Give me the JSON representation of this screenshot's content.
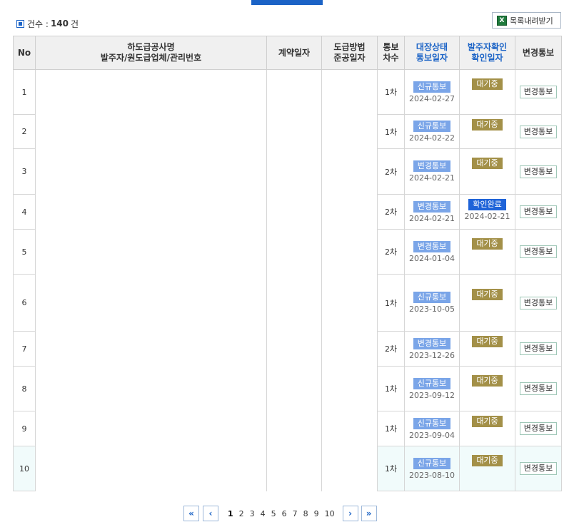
{
  "summary": {
    "label": "건수 :",
    "count": "140",
    "unit": "건"
  },
  "toolbar": {
    "download_label": "목록내려받기",
    "excel_icon": "X"
  },
  "table": {
    "headers": {
      "no": "No",
      "name_line1": "하도급공사명",
      "name_line2": "발주자/원도급업체/관리번호",
      "contract": "계약일자",
      "method_line1": "도급방법",
      "method_line2": "준공일자",
      "seq_line1": "통보",
      "seq_line2": "차수",
      "ledger_line1": "대장상태",
      "ledger_line2": "통보일자",
      "confirm_line1": "발주자확인",
      "confirm_line2": "확인일자",
      "change": "변경통보"
    },
    "rows": [
      {
        "no": "1",
        "seq": "1차",
        "status": "신규통보",
        "status_date": "2024-02-27",
        "confirm": "대기중",
        "confirm_date": "",
        "action": "변경통보"
      },
      {
        "no": "2",
        "seq": "1차",
        "status": "신규통보",
        "status_date": "2024-02-22",
        "confirm": "대기중",
        "confirm_date": "",
        "action": "변경통보"
      },
      {
        "no": "3",
        "seq": "2차",
        "status": "변경통보",
        "status_date": "2024-02-21",
        "confirm": "대기중",
        "confirm_date": "",
        "action": "변경통보"
      },
      {
        "no": "4",
        "seq": "2차",
        "status": "변경통보",
        "status_date": "2024-02-21",
        "confirm": "확인완료",
        "confirm_date": "2024-02-21",
        "action": "변경통보"
      },
      {
        "no": "5",
        "seq": "2차",
        "status": "변경통보",
        "status_date": "2024-01-04",
        "confirm": "대기중",
        "confirm_date": "",
        "action": "변경통보"
      },
      {
        "no": "6",
        "seq": "1차",
        "status": "신규통보",
        "status_date": "2023-10-05",
        "confirm": "대기중",
        "confirm_date": "",
        "action": "변경통보"
      },
      {
        "no": "7",
        "seq": "2차",
        "status": "변경통보",
        "status_date": "2023-12-26",
        "confirm": "대기중",
        "confirm_date": "",
        "action": "변경통보"
      },
      {
        "no": "8",
        "seq": "1차",
        "status": "신규통보",
        "status_date": "2023-09-12",
        "confirm": "대기중",
        "confirm_date": "",
        "action": "변경통보"
      },
      {
        "no": "9",
        "seq": "1차",
        "status": "신규통보",
        "status_date": "2023-09-04",
        "confirm": "대기중",
        "confirm_date": "",
        "action": "변경통보"
      },
      {
        "no": "10",
        "seq": "1차",
        "status": "신규통보",
        "status_date": "2023-08-10",
        "confirm": "대기중",
        "confirm_date": "",
        "action": "변경통보"
      }
    ]
  },
  "pagination": {
    "first": "«",
    "prev": "‹",
    "next": "›",
    "last": "»",
    "pages": [
      "1",
      "2",
      "3",
      "4",
      "5",
      "6",
      "7",
      "8",
      "9",
      "10"
    ],
    "current": "1"
  },
  "colors": {
    "accent": "#1b63c6",
    "status_badge": "#7aa5e8",
    "waiting_badge": "#a39048",
    "confirmed_badge": "#1e63d8"
  }
}
